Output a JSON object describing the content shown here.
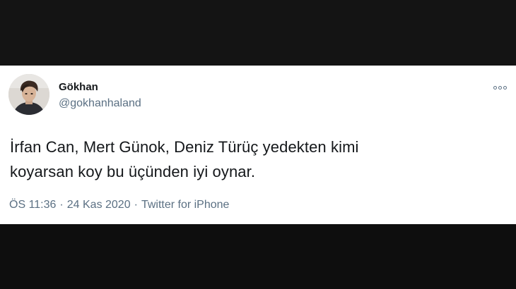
{
  "tweet": {
    "author": {
      "name": "Gökhan",
      "handle": "@gokhanhaland"
    },
    "text_lines": [
      "İrfan Can, Mert Günok, Deniz Türüç yedekten kimi",
      "koyarsan koy bu üçünden iyi oynar."
    ],
    "time": "ÖS 11:36",
    "date": "24 Kas 2020",
    "source": "Twitter for iPhone",
    "separator": "·"
  },
  "icons": {
    "avatar": "user-photo",
    "more": "more-options-icon"
  },
  "colors": {
    "card_background": "#ffffff",
    "letterbox": "#121212",
    "text_primary": "#14171a",
    "text_secondary": "#5b7083"
  }
}
